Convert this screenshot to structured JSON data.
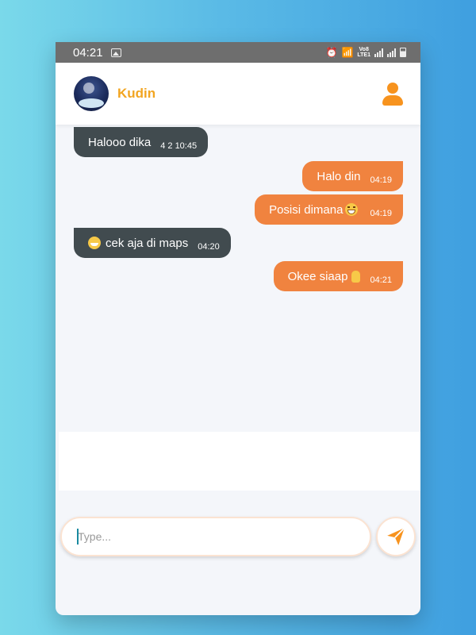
{
  "status_bar": {
    "time": "04:21",
    "gallery_icon": "image-icon",
    "volte_label": "Vo8\nLTE1"
  },
  "header": {
    "contact_name": "Kudin",
    "avatar_icon": "avatar-image",
    "profile_icon": "user-icon"
  },
  "messages": [
    {
      "direction": "in",
      "text": "Halooo dika",
      "time": "4 2 10:45"
    },
    {
      "direction": "out",
      "text": "Halo din",
      "time": "04:19"
    },
    {
      "direction": "out",
      "text": "Posisi dimana",
      "emoji": "grin-emoji",
      "time": "04:19"
    },
    {
      "direction": "in",
      "text": "cek aja di maps",
      "emoji": "smile-emoji",
      "time": "04:20"
    },
    {
      "direction": "out",
      "text": "Okee siaap",
      "emoji": "thumbs-up-emoji",
      "time": "04:21"
    }
  ],
  "composer": {
    "placeholder": "Type...",
    "value": "",
    "send_icon": "send-icon"
  },
  "colors": {
    "accent": "#f0833f",
    "name": "#f2a521",
    "incoming_bubble": "#414b4f",
    "background_gradient": [
      "#7ad9ea",
      "#3f9fe0"
    ]
  }
}
